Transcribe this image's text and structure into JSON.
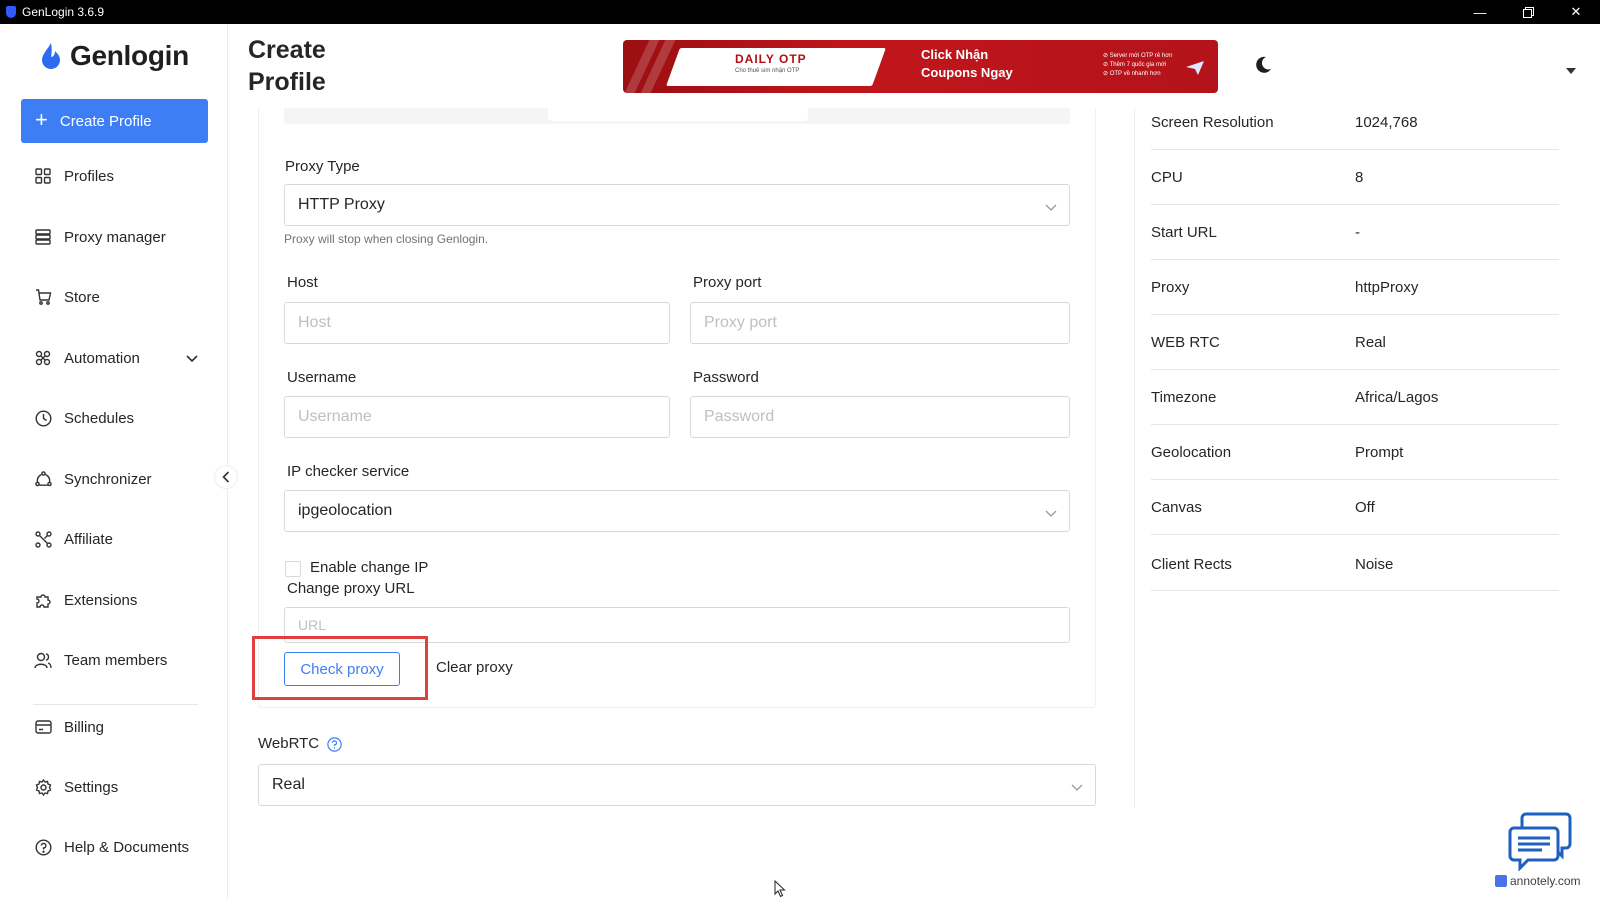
{
  "window": {
    "title": "GenLogin 3.6.9"
  },
  "brand": {
    "name": "Genlogin",
    "accent": "#3d7ef5"
  },
  "sidebar": {
    "create_label": "Create Profile",
    "items": [
      {
        "label": "Profiles",
        "icon": "grid-icon"
      },
      {
        "label": "Proxy manager",
        "icon": "server-icon"
      },
      {
        "label": "Store",
        "icon": "cart-icon"
      },
      {
        "label": "Automation",
        "icon": "automation-icon"
      },
      {
        "label": "Schedules",
        "icon": "clock-icon"
      },
      {
        "label": "Synchronizer",
        "icon": "sync-icon"
      },
      {
        "label": "Affiliate",
        "icon": "affiliate-icon"
      },
      {
        "label": "Extensions",
        "icon": "puzzle-icon"
      },
      {
        "label": "Team members",
        "icon": "users-icon"
      },
      {
        "label": "Billing",
        "icon": "card-icon"
      },
      {
        "label": "Settings",
        "icon": "gear-icon"
      },
      {
        "label": "Help & Documents",
        "icon": "help-icon"
      }
    ]
  },
  "header": {
    "title_line1": "Create",
    "title_line2": "Profile",
    "banner": {
      "brand": "DAILY OTP",
      "brand_sub": "Cho thuê sim nhận OTP",
      "cta_line1": "Click Nhận",
      "cta_line2": "Coupons Ngay",
      "bullet1": "⊘ Server mới OTP rẻ hơn",
      "bullet2": "⊘ Thêm 7 quốc gia mới",
      "bullet3": "⊘ OTP về nhanh hơn"
    }
  },
  "form": {
    "proxy_type_label": "Proxy Type",
    "proxy_type_value": "HTTP Proxy",
    "proxy_hint": "Proxy will stop when closing Genlogin.",
    "host_label": "Host",
    "host_placeholder": "Host",
    "port_label": "Proxy port",
    "port_placeholder": "Proxy port",
    "username_label": "Username",
    "username_placeholder": "Username",
    "password_label": "Password",
    "password_placeholder": "Password",
    "ip_checker_label": "IP checker service",
    "ip_checker_value": "ipgeolocation",
    "enable_change_ip_label": "Enable change IP",
    "enable_change_ip_checked": false,
    "change_proxy_url_label": "Change proxy URL",
    "url_placeholder": "URL",
    "check_proxy_label": "Check proxy",
    "clear_proxy_label": "Clear proxy",
    "webrtc_label": "WebRTC",
    "webrtc_value": "Real",
    "highlight_color": "#e0403b"
  },
  "summary": [
    {
      "key": "Screen Resolution",
      "value": "1024,768"
    },
    {
      "key": "CPU",
      "value": "8"
    },
    {
      "key": "Start URL",
      "value": "-"
    },
    {
      "key": "Proxy",
      "value": "httpProxy"
    },
    {
      "key": "WEB RTC",
      "value": "Real"
    },
    {
      "key": "Timezone",
      "value": "Africa/Lagos"
    },
    {
      "key": "Geolocation",
      "value": "Prompt"
    },
    {
      "key": "Canvas",
      "value": "Off"
    },
    {
      "key": "Client Rects",
      "value": "Noise"
    }
  ],
  "watermark": "annotely.com"
}
